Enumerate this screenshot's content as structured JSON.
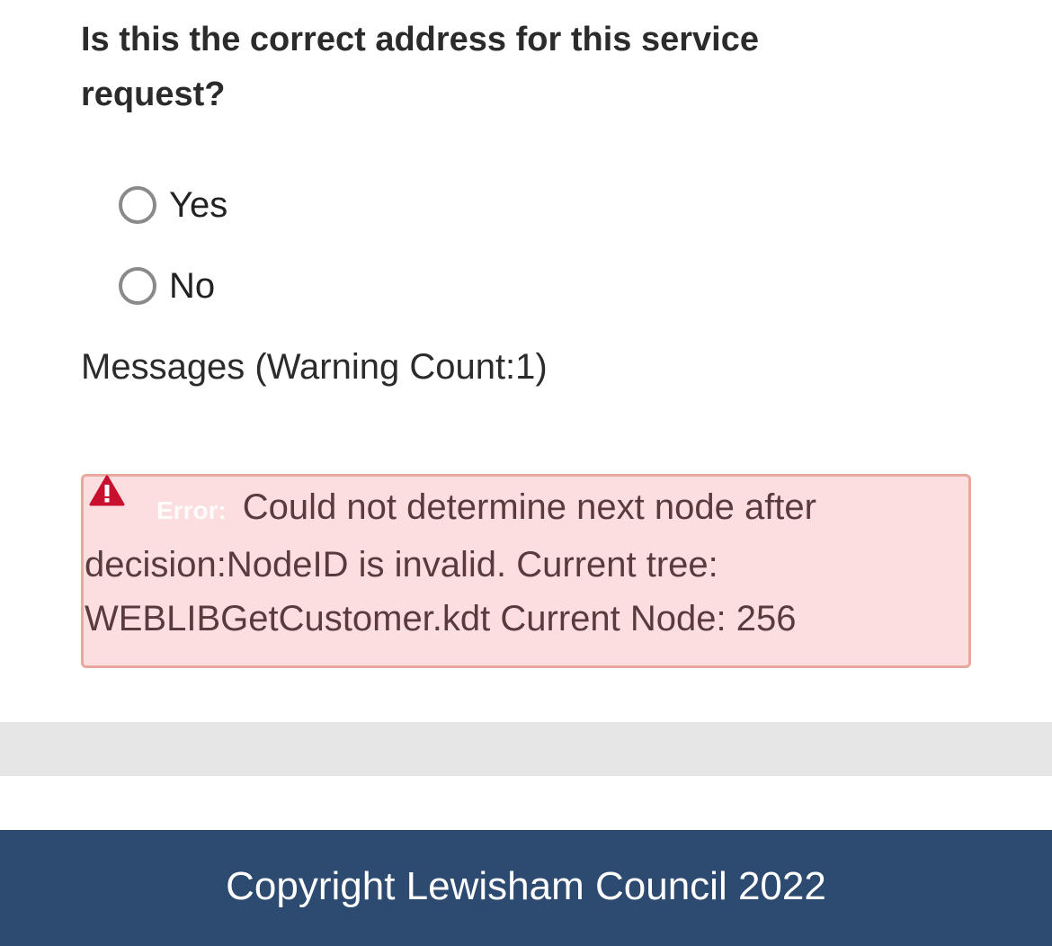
{
  "question": {
    "text": "Is this the correct address for this service request?"
  },
  "options": [
    {
      "label": "Yes",
      "selected": false
    },
    {
      "label": "No",
      "selected": false
    }
  ],
  "messages": {
    "heading": "Messages (Warning Count:1)"
  },
  "error": {
    "prefix": "Error:",
    "message": "Could not determine next node after decision:NodeID is invalid. Current tree: WEBLIBGetCustomer.kdt Current Node: 256",
    "icon": "warning-triangle-icon",
    "colors": {
      "background": "#fcdde0",
      "border": "#e8a89d",
      "icon": "#c8102e"
    }
  },
  "footer": {
    "text": "Copyright Lewisham Council 2022",
    "background": "#2d4a70"
  }
}
